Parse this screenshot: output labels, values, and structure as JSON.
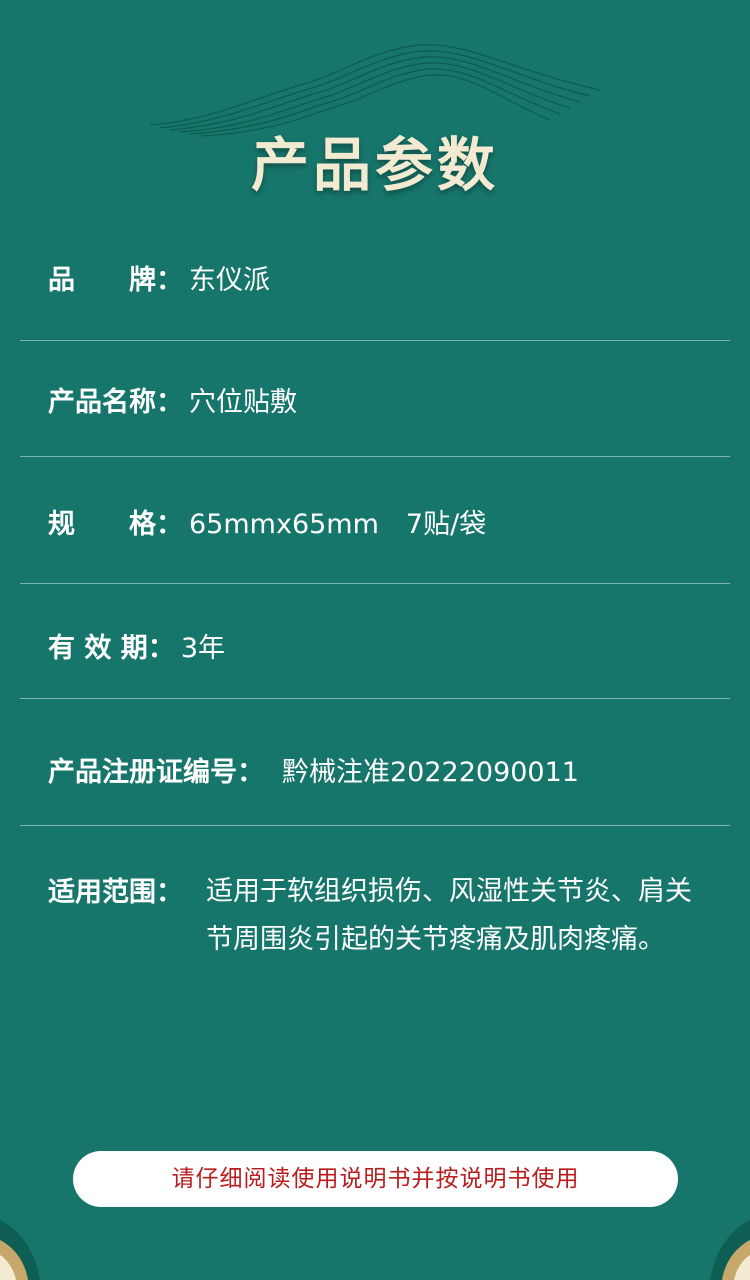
{
  "title": "产品参数",
  "params": {
    "brand": {
      "label": "品　　牌：",
      "value": "东仪派"
    },
    "product_name": {
      "label": "产品名称：",
      "value": "穴位贴敷"
    },
    "spec": {
      "label": "规　　格：",
      "value": "65mmx65mm　7贴/袋"
    },
    "validity": {
      "label": "有 效 期：",
      "value": "3年"
    },
    "registration": {
      "label": "产品注册证编号：",
      "value": "黔械注准20222090011"
    },
    "scope": {
      "label": "适用范围：",
      "value": "适用于软组织损伤、风湿性关节炎、肩关节周围炎引起的关节疼痛及肌肉疼痛。"
    }
  },
  "notice": "请仔细阅读使用说明书并按说明书使用",
  "colors": {
    "background": "#17766b",
    "title": "#f3ead2",
    "notice_text": "#b81e1e"
  }
}
